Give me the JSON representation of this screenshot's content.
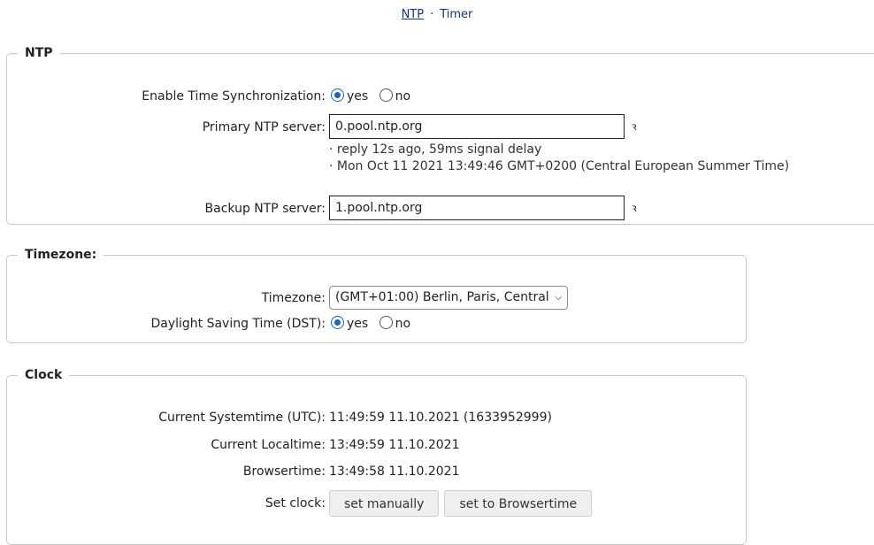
{
  "nav": {
    "ntp_link": "NTP",
    "separator": "·",
    "timer_link": "Timer"
  },
  "ntp": {
    "legend": "NTP",
    "enable_label": "Enable Time Synchronization:",
    "enable_yes": "yes",
    "enable_no": "no",
    "enable_selected": "yes",
    "primary_label": "Primary NTP server:",
    "primary_value": "0.pool.ntp.org",
    "primary_info_1": "· reply 12s ago, 59ms signal delay",
    "primary_info_2": "· Mon Oct 11 2021 13:49:46 GMT+0200 (Central European Summer Time)",
    "backup_label": "Backup NTP server:",
    "backup_value": "1.pool.ntp.org",
    "rss_icon": "ꝛ"
  },
  "timezone": {
    "legend": "Timezone:",
    "tz_label": "Timezone:",
    "tz_value": "(GMT+01:00) Berlin, Paris, Central",
    "dst_label": "Daylight Saving Time (DST):",
    "dst_yes": "yes",
    "dst_no": "no",
    "dst_selected": "yes"
  },
  "clock": {
    "legend": "Clock",
    "sys_label": "Current Systemtime (UTC):",
    "sys_value": "11:49:59 11.10.2021 (1633952999)",
    "local_label": "Current Localtime:",
    "local_value": "13:49:59 11.10.2021",
    "browser_label": "Browsertime:",
    "browser_value": "13:49:58 11.10.2021",
    "set_label": "Set clock:",
    "set_manually": "set manually",
    "set_browser": "set to Browsertime"
  }
}
